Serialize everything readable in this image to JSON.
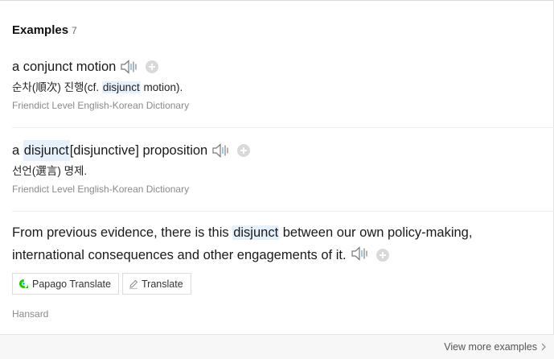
{
  "header": {
    "title": "Examples",
    "count": "7"
  },
  "examples": [
    {
      "en_before": "a conjunct motion",
      "ko_before": "순차(順次) 진행(cf. ",
      "ko_highlight": "disjunct",
      "ko_after": " motion).",
      "source": "Friendict Level English-Korean Dictionary"
    },
    {
      "en_before": "a ",
      "en_highlight": "disjunct",
      "en_after": "[disjunctive] proposition",
      "ko": "선언(選言) 명제.",
      "source": "Friendict Level English-Korean Dictionary"
    },
    {
      "en_before": "From previous evidence, there is this ",
      "en_highlight": "disjunct",
      "en_after": " between our own policy-making, international consequences and other engagements of it.",
      "papago_label": "Papago Translate",
      "translate_label": "Translate",
      "source": "Hansard"
    }
  ],
  "footer": {
    "view_more": "View more examples"
  },
  "colors": {
    "highlight": "#e6f1fb",
    "papago": "#1ec800",
    "speaker": "#888888"
  },
  "icons": [
    "speaker-icon",
    "add-icon",
    "papago-icon",
    "pencil-icon",
    "chevron-right-icon"
  ]
}
